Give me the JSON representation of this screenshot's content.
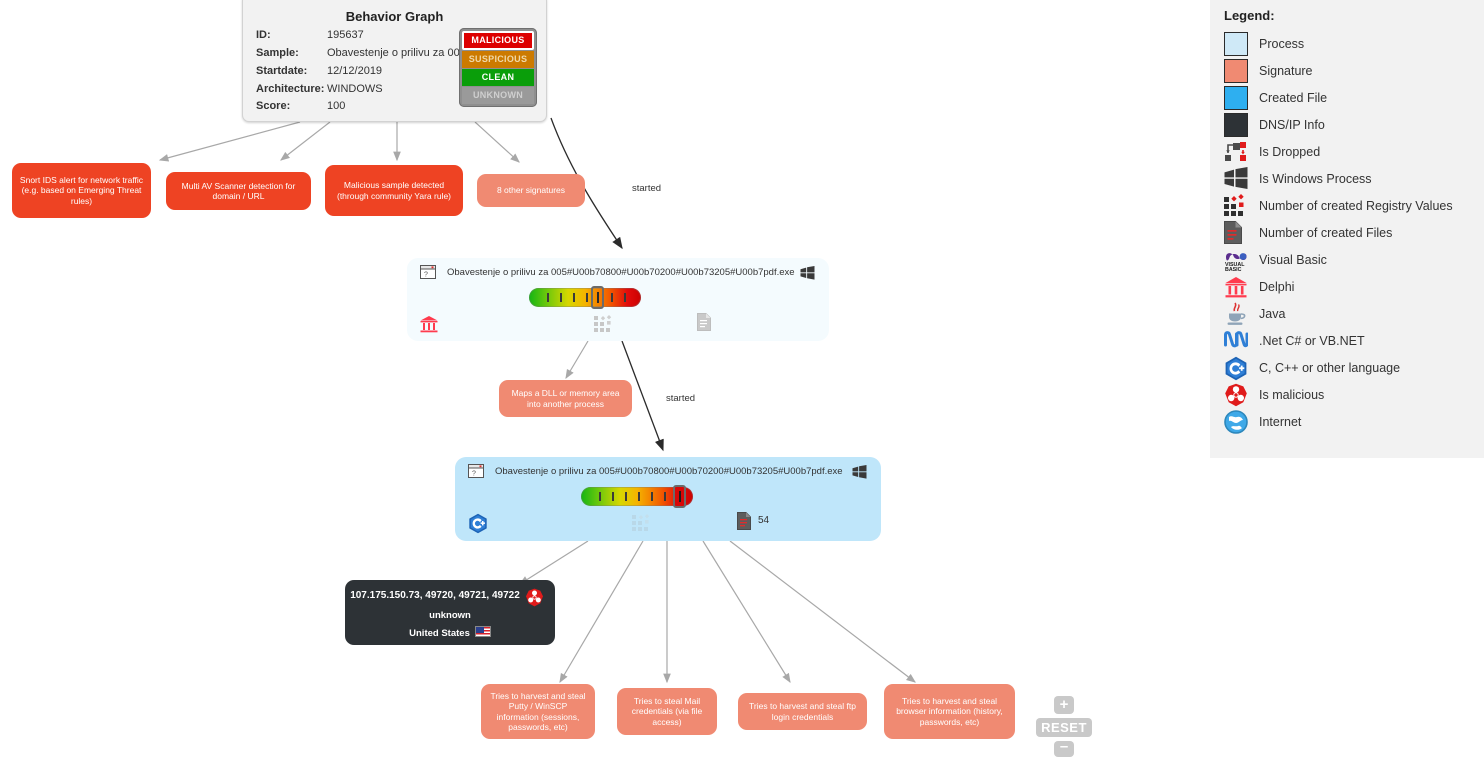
{
  "info_panel": {
    "title": "Behavior Graph",
    "rows": [
      {
        "key": "ID:",
        "value": "195637"
      },
      {
        "key": "Sample:",
        "value": "Obavestenje o prilivu za 00..."
      },
      {
        "key": "Startdate:",
        "value": "12/12/2019"
      },
      {
        "key": "Architecture:",
        "value": "WINDOWS"
      },
      {
        "key": "Score:",
        "value": "100"
      }
    ],
    "verdicts": [
      {
        "label": "MALICIOUS",
        "state": "selected"
      },
      {
        "label": "SUSPICIOUS",
        "state": "normal"
      },
      {
        "label": "CLEAN",
        "state": "normal"
      },
      {
        "label": "UNKNOWN",
        "state": "normal"
      }
    ]
  },
  "top_signatures": [
    {
      "text": "Snort IDS alert for network traffic (e.g. based on Emerging Threat rules)",
      "tone": "solid"
    },
    {
      "text": "Multi AV Scanner detection for domain / URL",
      "tone": "solid"
    },
    {
      "text": "Malicious sample detected (through community Yara rule)",
      "tone": "solid"
    },
    {
      "text": "8 other signatures",
      "tone": "light"
    }
  ],
  "process_1": {
    "title": "Obavestenje o prilivu za 005#U00b70800#U00b70200#U00b73205#U00b7pdf.exe",
    "language_icon": "delphi-icon",
    "registry_icon": "registry-values-icon",
    "files_icon": "created-files-icon",
    "files_count": "",
    "os_icon": "windows-icon",
    "score_marker_percent": 50
  },
  "process_2": {
    "title": "Obavestenje o prilivu za 005#U00b70800#U00b70200#U00b73205#U00b7pdf.exe",
    "language_icon": "c-cpp-icon",
    "registry_icon": "registry-values-icon",
    "files_icon": "created-files-icon",
    "files_count": "54",
    "os_icon": "windows-icon",
    "score_marker_percent": 85
  },
  "mid_signature": {
    "text": "Maps a DLL or memory area into another process"
  },
  "edge_labels": {
    "started_1": "started",
    "started_2": "started"
  },
  "dns_node": {
    "addresses": "107.175.150.73, 49720, 49721, 49722",
    "hostname": "unknown",
    "country": "United States",
    "malicious_icon": "is-malicious-icon",
    "flag_icon": "us-flag-icon"
  },
  "bottom_signatures": [
    {
      "text": "Tries to harvest and steal Putty / WinSCP information (sessions, passwords, etc)"
    },
    {
      "text": "Tries to steal Mail credentials (via file access)"
    },
    {
      "text": "Tries to harvest and steal ftp login credentials"
    },
    {
      "text": "Tries to harvest and steal browser information (history, passwords, etc)"
    }
  ],
  "legend": {
    "title": "Legend:",
    "items": [
      {
        "label": "Process",
        "icon": "process-swatch"
      },
      {
        "label": "Signature",
        "icon": "signature-swatch"
      },
      {
        "label": "Created File",
        "icon": "created-file-swatch"
      },
      {
        "label": "DNS/IP Info",
        "icon": "dns-ip-swatch"
      },
      {
        "label": "Is Dropped",
        "icon": "is-dropped-icon"
      },
      {
        "label": "Is Windows Process",
        "icon": "windows-icon"
      },
      {
        "label": "Number of created Registry Values",
        "icon": "registry-values-icon"
      },
      {
        "label": "Number of created Files",
        "icon": "created-files-icon"
      },
      {
        "label": "Visual Basic",
        "icon": "visual-basic-icon"
      },
      {
        "label": "Delphi",
        "icon": "delphi-icon"
      },
      {
        "label": "Java",
        "icon": "java-icon"
      },
      {
        "label": ".Net C# or VB.NET",
        "icon": "dotnet-icon"
      },
      {
        "label": "C, C++ or other language",
        "icon": "c-cpp-icon"
      },
      {
        "label": "Is malicious",
        "icon": "is-malicious-icon"
      },
      {
        "label": "Internet",
        "icon": "internet-icon"
      }
    ]
  },
  "zoom_controls": {
    "zoom_in": "+",
    "reset": "RESET",
    "zoom_out": "–"
  },
  "colors": {
    "signature": "#ee4323",
    "signature_light": "#f08a72",
    "process_pale": "#f4fbfe",
    "process_blue": "#bfe6fa",
    "dns": "#2d3236",
    "malicious": "#dd0000",
    "clean": "#0a9e0a"
  }
}
